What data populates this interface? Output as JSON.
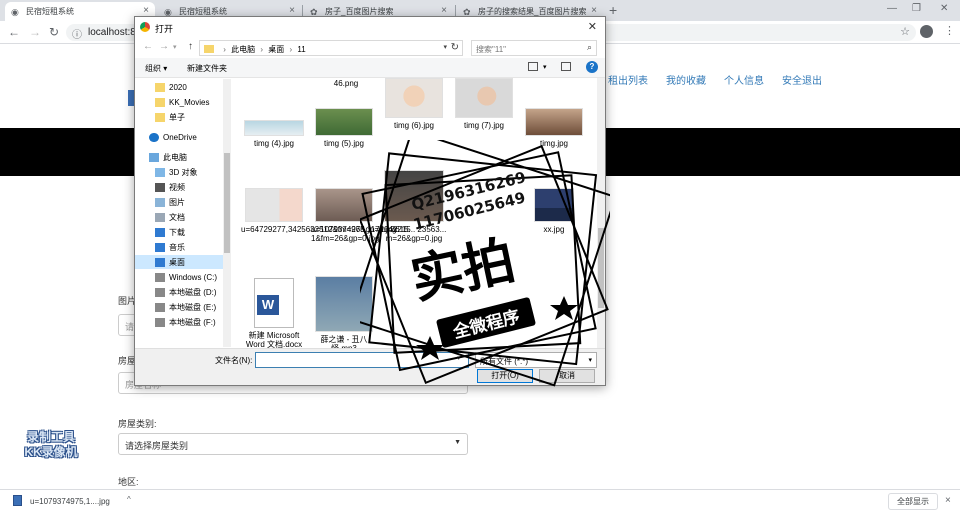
{
  "browser": {
    "tabs": [
      {
        "title": "民宿短租系统",
        "active": true
      },
      {
        "title": "民宿短租系统",
        "active": false
      },
      {
        "title": "房子_百度图片搜索",
        "active": false
      },
      {
        "title": "房子的搜索结果_百度图片搜索",
        "active": false
      }
    ],
    "url": "localhost:8"
  },
  "site": {
    "nav": [
      "租出列表",
      "我的收藏",
      "个人信息",
      "安全退出"
    ],
    "form": {
      "image_label": "图片",
      "image_placeholder": "请",
      "house_name_label": "房屋名",
      "house_name_placeholder": "房屋名称",
      "house_type_label": "房屋类别:",
      "house_type_value": "请选择房屋类别",
      "region_label": "地区:"
    }
  },
  "dialog": {
    "title": "打开",
    "breadcrumb": [
      "此电脑",
      "桌面",
      "11"
    ],
    "search_placeholder": "搜索\"11\"",
    "organize": "组织 ▾",
    "new_folder": "新建文件夹",
    "help": "?",
    "nav_items": [
      {
        "label": "2020",
        "icon": "folder-icon"
      },
      {
        "label": "KK_Movies",
        "icon": "folder-icon"
      },
      {
        "label": "单子",
        "icon": "folder-icon"
      },
      {
        "label": "OneDrive",
        "icon": "cloud-icon"
      },
      {
        "label": "此电脑",
        "icon": "computer-icon"
      },
      {
        "label": "3D 对象",
        "icon": "cube-icon"
      },
      {
        "label": "视频",
        "icon": "video-icon"
      },
      {
        "label": "图片",
        "icon": "picture-icon"
      },
      {
        "label": "文档",
        "icon": "document-icon"
      },
      {
        "label": "下载",
        "icon": "download-icon"
      },
      {
        "label": "音乐",
        "icon": "music-icon"
      },
      {
        "label": "桌面",
        "icon": "desktop-icon"
      },
      {
        "label": "Windows (C:)",
        "icon": "drive-icon"
      },
      {
        "label": "本地磁盘 (D:)",
        "icon": "drive-icon"
      },
      {
        "label": "本地磁盘 (E:)",
        "icon": "drive-icon"
      },
      {
        "label": "本地磁盘 (F:)",
        "icon": "drive-icon"
      }
    ],
    "files": [
      {
        "name": "46.png"
      },
      {
        "name": "timg (4).jpg"
      },
      {
        "name": "timg (5).jpg"
      },
      {
        "name": "timg (6).jpg"
      },
      {
        "name": "timg (7).jpg"
      },
      {
        "name": "timg.jpg"
      },
      {
        "name": "u=64729277,3425632512&fm=26&gp=0.jpg"
      },
      {
        "name": "u=1079374975,1172042215 1&fm=26&gp=0.jpg"
      },
      {
        "name": "u=3615... 23563... m=26&gp=0.jpg"
      },
      {
        "name": "xx.jpg"
      },
      {
        "name": "新建 Microsoft Word 文档.docx"
      },
      {
        "name": "薛之谦 - 丑八怪.mp3"
      }
    ],
    "filename_label": "文件名(N):",
    "filename_value": "",
    "file_type": "所有文件 (*.*)",
    "open_button": "打开(O)",
    "cancel_button": "取消"
  },
  "stamp": {
    "phone1": "Q2196316269",
    "phone2": "11706025649",
    "big": "实拍",
    "banner": "全微程序"
  },
  "watermark": {
    "line1": "录制工具",
    "line2": "KK录像机"
  },
  "download": {
    "file": "u=1079374975,1....jpg",
    "show_all": "全部显示"
  }
}
